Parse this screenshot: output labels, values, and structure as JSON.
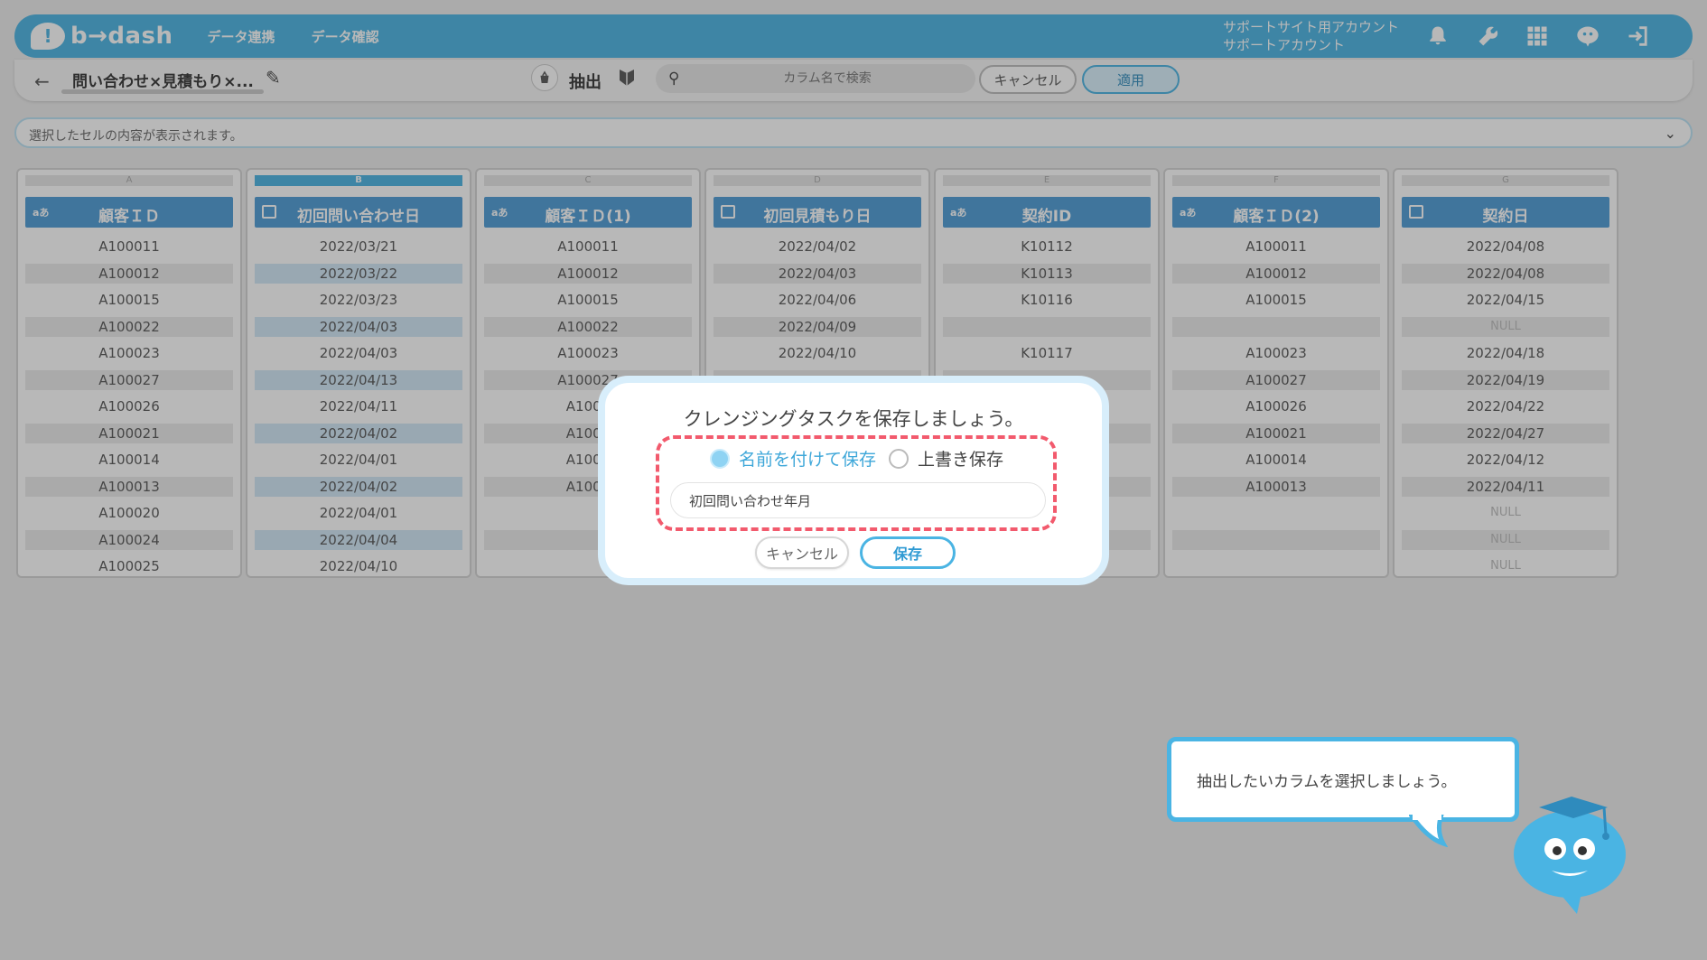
{
  "header": {
    "logo_mark": "!",
    "logo_text": "b→dash",
    "nav": [
      "データ連携",
      "データ確認"
    ],
    "account_line1": "サポートサイト用アカウント",
    "account_line2": "サポートアカウント",
    "icons": [
      "bell-icon",
      "wrench-icon",
      "apps-grid-icon",
      "mascot-chat-icon",
      "logout-icon"
    ],
    "accent_color": "#4ab4e3"
  },
  "toolbar": {
    "back": "←",
    "task_title": "問い合わせ×見積もり×...",
    "edit_icon": "✎",
    "extract_label": "抽出",
    "search_placeholder": "カラム名で検索",
    "cancel_label": "キャンセル",
    "apply_label": "適用"
  },
  "cell_bar": {
    "placeholder": "選択したセルの内容が表示されます。",
    "chevron": "⌄"
  },
  "grid": {
    "columns": [
      {
        "letter": "A",
        "type": "text",
        "type_icon": "aあ",
        "name": "顧客ＩＤ",
        "rows": [
          "A100011",
          "A100012",
          "A100015",
          "A100022",
          "A100023",
          "A100027",
          "A100026",
          "A100021",
          "A100014",
          "A100013",
          "A100020",
          "A100024",
          "A100025"
        ]
      },
      {
        "letter": "B",
        "type": "date",
        "type_icon": "",
        "name": "初回問い合わせ日",
        "rows": [
          "2022/03/21",
          "2022/03/22",
          "2022/03/23",
          "2022/04/03",
          "2022/04/03",
          "2022/04/13",
          "2022/04/11",
          "2022/04/02",
          "2022/04/01",
          "2022/04/02",
          "2022/04/01",
          "2022/04/04",
          "2022/04/10"
        ]
      },
      {
        "letter": "C",
        "type": "text",
        "type_icon": "aあ",
        "name": "顧客ＩＤ(1)",
        "rows": [
          "A100011",
          "A100012",
          "A100015",
          "A100022",
          "A100023",
          "A100027",
          "A1000",
          "A1000",
          "A1000",
          "A1000",
          "",
          "",
          ""
        ]
      },
      {
        "letter": "D",
        "type": "date",
        "type_icon": "",
        "name": "初回見積もり日",
        "rows": [
          "2022/04/02",
          "2022/04/03",
          "2022/04/06",
          "2022/04/09",
          "2022/04/10",
          "",
          "",
          "",
          "",
          "",
          "",
          "",
          ""
        ]
      },
      {
        "letter": "E",
        "type": "text",
        "type_icon": "aあ",
        "name": "契約ID",
        "rows": [
          "K10112",
          "K10113",
          "K10116",
          "",
          "K10117",
          "",
          "",
          "",
          "",
          "",
          "",
          "",
          ""
        ]
      },
      {
        "letter": "F",
        "type": "text",
        "type_icon": "aあ",
        "name": "顧客ＩＤ(2)",
        "rows": [
          "A100011",
          "A100012",
          "A100015",
          "",
          "A100023",
          "A100027",
          "A100026",
          "A100021",
          "A100014",
          "A100013",
          "",
          "",
          ""
        ]
      },
      {
        "letter": "G",
        "type": "date",
        "type_icon": "",
        "name": "契約日",
        "rows": [
          "2022/04/08",
          "2022/04/08",
          "2022/04/15",
          "NULL",
          "2022/04/18",
          "2022/04/19",
          "2022/04/22",
          "2022/04/27",
          "2022/04/12",
          "2022/04/11",
          "NULL",
          "NULL",
          "NULL"
        ]
      }
    ]
  },
  "modal": {
    "title": "クレンジングタスクを保存しましょう。",
    "option_new": "名前を付けて保存",
    "option_overwrite": "上書き保存",
    "selected_option": "名前を付けて保存",
    "name_value": "初回問い合わせ年月",
    "cancel_label": "キャンセル",
    "save_label": "保存",
    "highlight_color": "#f25a6d"
  },
  "tutorial": {
    "message": "抽出したいカラムを選択しましょう。"
  }
}
